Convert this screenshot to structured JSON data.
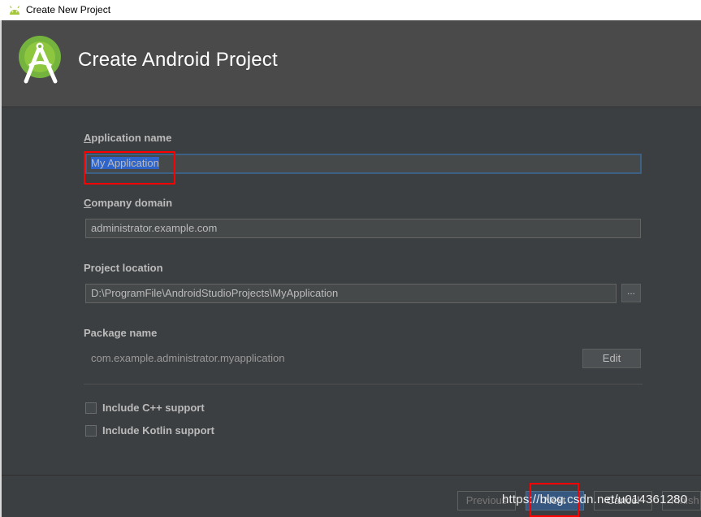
{
  "window": {
    "title": "Create New Project"
  },
  "header": {
    "title": "Create Android Project",
    "logo_icon": "android-studio-logo-icon"
  },
  "form": {
    "application_name": {
      "label_mnemonic": "A",
      "label_rest": "pplication name",
      "value": "My Application"
    },
    "company_domain": {
      "label_mnemonic": "C",
      "label_rest": "ompany domain",
      "value": "administrator.example.com"
    },
    "project_location": {
      "label": "Project location",
      "value": "D:\\ProgramFile\\AndroidStudioProjects\\MyApplication",
      "browse_label": "..."
    },
    "package_name": {
      "label": "Package name",
      "value": "com.example.administrator.myapplication",
      "edit_label": "Edit"
    },
    "include_cpp": {
      "label": "Include C++ support",
      "checked": false
    },
    "include_kotlin": {
      "label": "Include Kotlin support",
      "checked": false
    }
  },
  "footer": {
    "previous_label": "Previous",
    "next_label": "Next",
    "cancel_label": "Cancel",
    "finish_label": "Finish"
  },
  "watermark": "https://blog.csdn.net/u014361280",
  "colors": {
    "background": "#3c3f41",
    "header_bg": "#4a4a4a",
    "android_green": "#a4c639",
    "annotation_red": "#ff0000",
    "selection_blue": "#2f65ca"
  }
}
